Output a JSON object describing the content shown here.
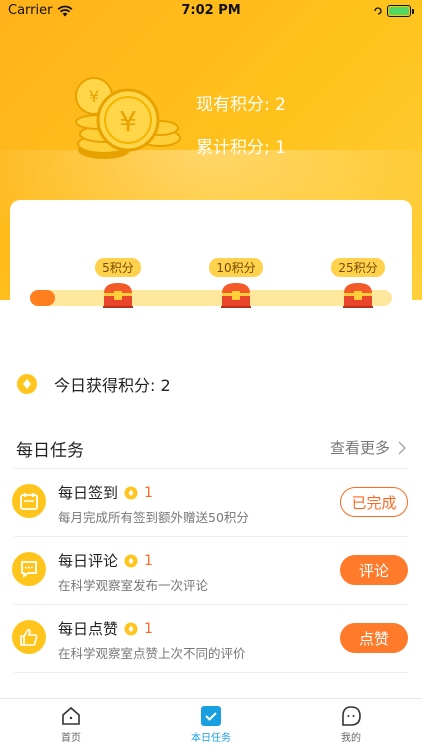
{
  "status_bar": {
    "carrier": "Carrier",
    "time": "7:02 PM"
  },
  "points": {
    "current": "现有积分: 2",
    "total": "累计积分; 1"
  },
  "progress": {
    "fraction": 0.05,
    "milestones": [
      {
        "label": "5积分"
      },
      {
        "label": "10积分"
      },
      {
        "label": "25积分"
      }
    ]
  },
  "today": {
    "text": "今日获得积分: 2"
  },
  "tasks_section": {
    "title": "每日任务",
    "more": "查看更多"
  },
  "tasks": [
    {
      "title": "每日签到",
      "points": "1",
      "desc": "每月完成所有签到额外赠送50积分",
      "button": "已完成",
      "icon": "calendar-icon"
    },
    {
      "title": "每日评论",
      "points": "1",
      "desc": "在科学观察室发布一次评论",
      "button": "评论",
      "icon": "comment-icon"
    },
    {
      "title": "每日点赞",
      "points": "1",
      "desc": "在科学观察室点赞上次不同的评价",
      "button": "点赞",
      "icon": "thumbs-up-icon"
    }
  ],
  "tab_bar": [
    {
      "label": "首页",
      "icon": "home-icon"
    },
    {
      "label": "本日任务",
      "icon": "task-check-icon"
    },
    {
      "label": "我的",
      "icon": "profile-icon"
    }
  ],
  "colors": {
    "accent": "#ff7a2a",
    "header": "#ffb21a",
    "tab_active": "#19a0e0",
    "coin": "#ffc51c"
  }
}
